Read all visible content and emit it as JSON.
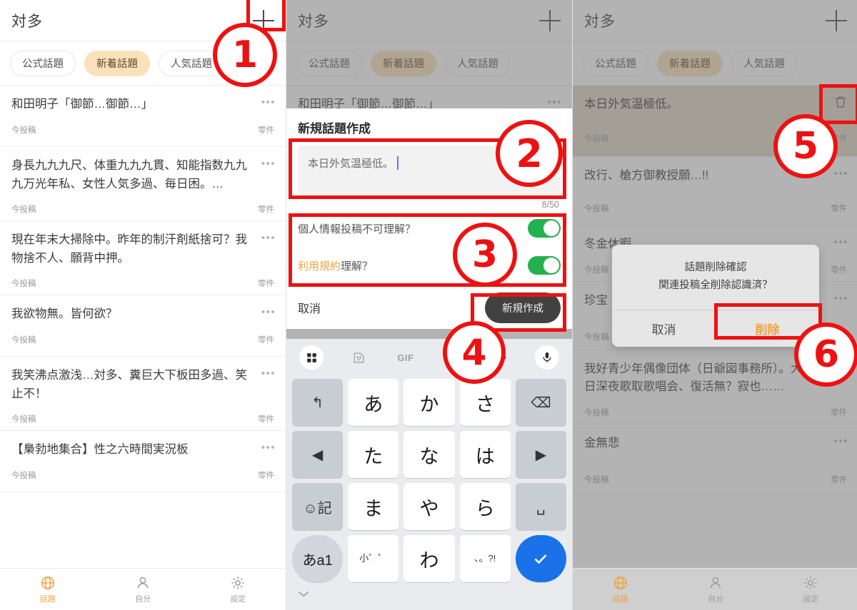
{
  "app": {
    "title": "対多",
    "add_icon": "plus-icon"
  },
  "tabs": [
    {
      "label": "公式話題",
      "active": false
    },
    {
      "label": "新着話題",
      "active": true
    },
    {
      "label": "人気話題",
      "active": false
    }
  ],
  "bottom_nav": [
    {
      "label": "話題",
      "icon": "globe-icon",
      "active": true
    },
    {
      "label": "自分",
      "icon": "person-icon",
      "active": false
    },
    {
      "label": "設定",
      "icon": "gear-icon",
      "active": false
    }
  ],
  "meta": {
    "posted": "今投稿",
    "posted_alt": "今投稿",
    "count": "零件",
    "more_icon": "more-dots-icon",
    "trash_icon": "trash-icon"
  },
  "panel1": {
    "items": [
      {
        "title": "和田明子「御節…御節…」",
        "time": "今投稿",
        "count": "零件"
      },
      {
        "title": "身長九九九尺、体重九九九貫、知能指数九九九万光年私、女性人気多過、毎日困。…",
        "time": "今投稿",
        "count": "零件"
      },
      {
        "title": "現在年末大掃除中。昨年的制汗剤紙捨可？我物捨不人、願背中押。",
        "time": "今投稿",
        "count": "零件"
      },
      {
        "title": "我欲物無。皆何欲？",
        "time": "今投稿",
        "count": "零件"
      },
      {
        "title": "我笑沸点激浅…対多、糞巨大下板田多過、笑止不！",
        "time": "今投稿",
        "count": "零件"
      },
      {
        "title": "【梟勃地集合】性之六時間実況板",
        "time": "今投稿",
        "count": "零件"
      }
    ]
  },
  "panel2": {
    "background_item": "和田明子「御節…御節…」",
    "compose": {
      "title": "新規話題作成",
      "input_value": "本日外気温極低。",
      "placeholder": "本日外気温極低。",
      "counter": "8/50",
      "options": [
        {
          "label_plain": "個人情報投稿不可理解？",
          "link_text": "",
          "label_tail": "",
          "enabled": true
        },
        {
          "label_plain": "",
          "link_text": "利用規約",
          "label_tail": "理解？",
          "enabled": true
        }
      ],
      "cancel_label": "取消",
      "submit_label": "新規作成"
    },
    "keyboard": {
      "toolbar": [
        "grid-icon",
        "sticker-icon",
        "GIF",
        "clipboard-icon",
        "palette-icon",
        "mic-icon"
      ],
      "rows": [
        [
          {
            "label": "↰",
            "type": "fn",
            "name": "undo-key"
          },
          {
            "label": "あ",
            "type": "char",
            "name": "key-a"
          },
          {
            "label": "か",
            "type": "char",
            "name": "key-ka"
          },
          {
            "label": "さ",
            "type": "char",
            "name": "key-sa"
          },
          {
            "label": "⌫",
            "type": "fn",
            "name": "backspace-key"
          }
        ],
        [
          {
            "label": "◀",
            "type": "fn",
            "name": "cursor-left-key"
          },
          {
            "label": "た",
            "type": "char",
            "name": "key-ta"
          },
          {
            "label": "な",
            "type": "char",
            "name": "key-na"
          },
          {
            "label": "は",
            "type": "char",
            "name": "key-ha"
          },
          {
            "label": "▶",
            "type": "fn",
            "name": "cursor-right-key"
          }
        ],
        [
          {
            "label": "☺記",
            "type": "fn",
            "name": "emoji-symbol-key"
          },
          {
            "label": "ま",
            "type": "char",
            "name": "key-ma"
          },
          {
            "label": "や",
            "type": "char",
            "name": "key-ya"
          },
          {
            "label": "ら",
            "type": "char",
            "name": "key-ra"
          },
          {
            "label": "␣",
            "type": "fn",
            "name": "space-key"
          }
        ],
        [
          {
            "label": "あa1",
            "type": "round",
            "name": "input-mode-key"
          },
          {
            "label": "小゛゜",
            "type": "small",
            "name": "dakuten-key"
          },
          {
            "label": "わ",
            "type": "char",
            "name": "key-wa"
          },
          {
            "label": "、。?!",
            "type": "small",
            "name": "punctuation-key"
          },
          {
            "label": "✓",
            "type": "enter",
            "name": "enter-key"
          }
        ]
      ],
      "collapse_icon": "chevron-down-icon"
    }
  },
  "panel3": {
    "items": [
      {
        "title": "本日外気温極低。",
        "time": "今投稿",
        "count": "零件",
        "selected": true,
        "action": "trash"
      },
      {
        "title": "改行、槍方御教授願…!!",
        "time": "今投稿",
        "count": "零件",
        "selected": false,
        "action": "more"
      },
      {
        "title": "冬金休暇",
        "time": "今投稿",
        "count": "零件",
        "selected": false,
        "action": "more"
      },
      {
        "title": "珍宝",
        "time": "今投稿",
        "count": "零件",
        "selected": false,
        "action": "more"
      },
      {
        "title": "我好青少年偶像団体（日爺図事務所）。大晦日深夜歌取歌唱会、復活無？寂也……",
        "time": "今投稿",
        "count": "零件",
        "selected": false,
        "action": "more"
      },
      {
        "title": "金無悲",
        "time": "今投稿",
        "count": "零件",
        "selected": false,
        "action": "more"
      }
    ],
    "dialog": {
      "line1": "話題削除確認",
      "line2": "関連投稿全削除認識済？",
      "cancel_label": "取消",
      "delete_label": "削除"
    }
  },
  "annotations": [
    {
      "number": "1"
    },
    {
      "number": "2"
    },
    {
      "number": "3"
    },
    {
      "number": "4"
    },
    {
      "number": "5"
    },
    {
      "number": "6"
    }
  ],
  "colors": {
    "accent_orange": "#f0a341",
    "pill_active": "#fbe1bb",
    "toggle_on": "#22b14c",
    "annotation_red": "#ee1111",
    "row_selected": "#e0d6c3",
    "primary_button": "#414141",
    "enter_key_blue": "#1b72e8"
  }
}
